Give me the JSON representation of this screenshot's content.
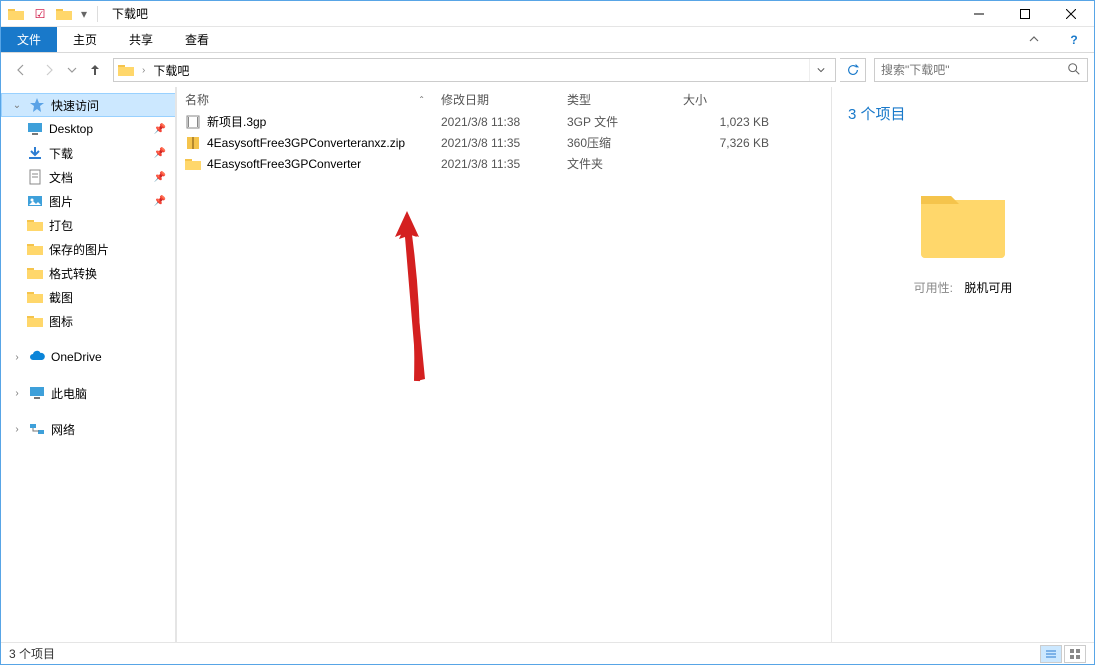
{
  "window": {
    "title": "下载吧",
    "ribbon_dropdown_help": "?"
  },
  "ribbon": {
    "file": "文件",
    "home": "主页",
    "share": "共享",
    "view": "查看"
  },
  "address": {
    "location": "下载吧"
  },
  "search": {
    "placeholder": "搜索\"下载吧\""
  },
  "sidebar": {
    "quick_access": "快速访问",
    "items": [
      {
        "label": "Desktop",
        "icon": "desktop"
      },
      {
        "label": "下载",
        "icon": "downloads"
      },
      {
        "label": "文档",
        "icon": "documents"
      },
      {
        "label": "图片",
        "icon": "pictures"
      },
      {
        "label": "打包",
        "icon": "folder"
      },
      {
        "label": "保存的图片",
        "icon": "folder"
      },
      {
        "label": "格式转换",
        "icon": "folder"
      },
      {
        "label": "截图",
        "icon": "folder"
      },
      {
        "label": "图标",
        "icon": "folder"
      }
    ],
    "onedrive": "OneDrive",
    "this_pc": "此电脑",
    "network": "网络"
  },
  "columns": {
    "name": "名称",
    "date": "修改日期",
    "type": "类型",
    "size": "大小"
  },
  "files": [
    {
      "name": "新项目.3gp",
      "date": "2021/3/8 11:38",
      "type": "3GP 文件",
      "size": "1,023 KB",
      "icon": "video"
    },
    {
      "name": "4EasysoftFree3GPConverteranxz.zip",
      "date": "2021/3/8 11:35",
      "type": "360压缩",
      "size": "7,326 KB",
      "icon": "zip"
    },
    {
      "name": "4EasysoftFree3GPConverter",
      "date": "2021/3/8 11:35",
      "type": "文件夹",
      "size": "",
      "icon": "folder"
    }
  ],
  "details": {
    "title": "3 个项目",
    "availability_label": "可用性:",
    "availability_value": "脱机可用"
  },
  "status": {
    "text": "3 个项目"
  }
}
